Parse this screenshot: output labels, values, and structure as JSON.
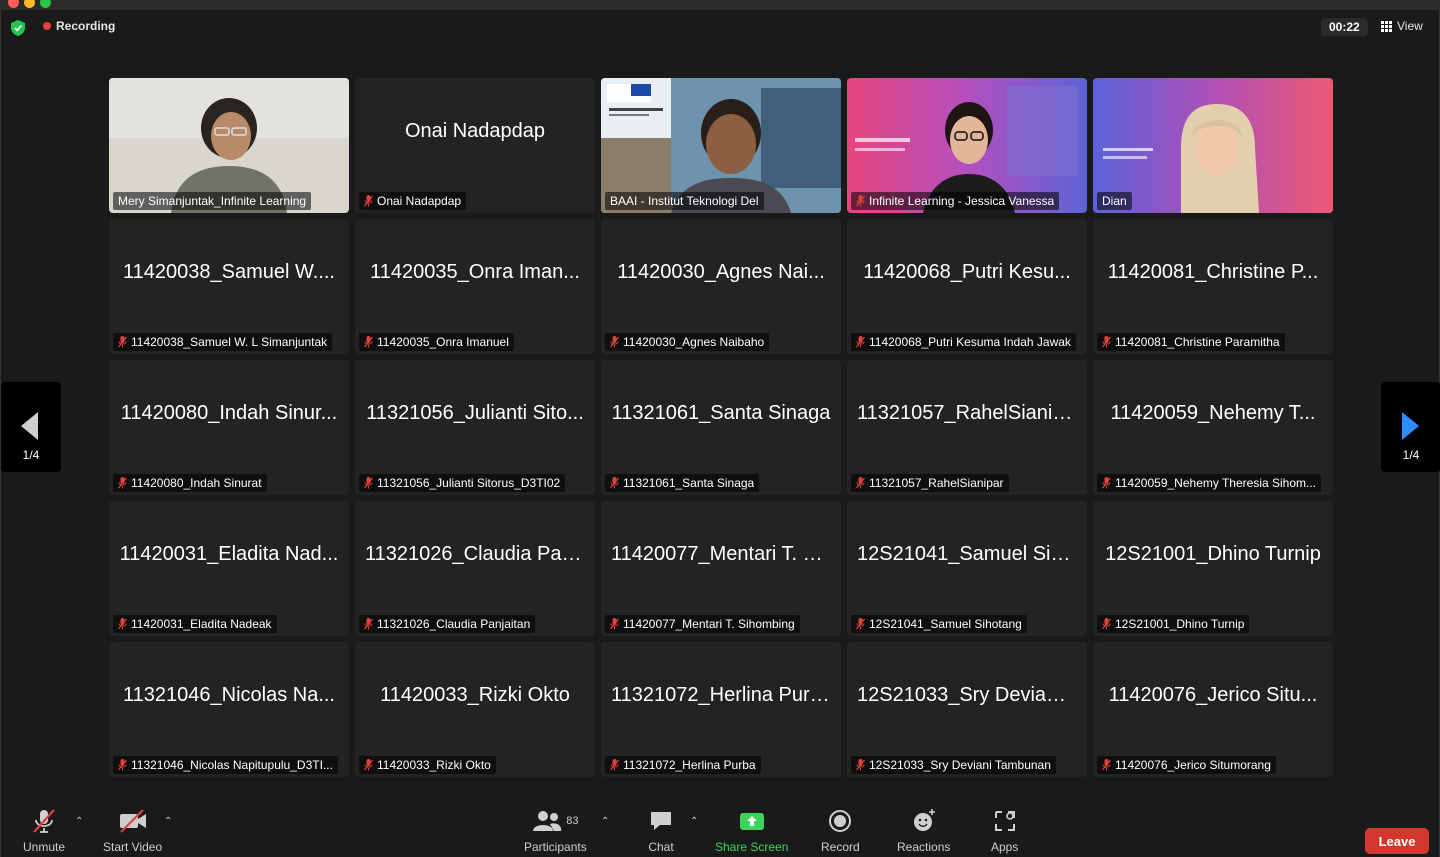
{
  "topbar": {
    "recording_label": "Recording",
    "timer": "00:22",
    "view_label": "View"
  },
  "video_tiles": [
    {
      "label": "Mery Simanjuntak_Infinite Learning",
      "muted": false
    },
    {
      "name": "Onai Nadapdap",
      "label": "Onai Nadapdap",
      "muted": true
    },
    {
      "label": "BAAI - Institut Teknologi Del",
      "muted": false,
      "active": true
    },
    {
      "label": "Infinite Learning - Jessica Vanessa",
      "muted": true
    },
    {
      "label": "Dian",
      "muted": false
    }
  ],
  "participants": [
    {
      "name": "11420038_Samuel W....",
      "label": "11420038_Samuel W. L Simanjuntak"
    },
    {
      "name": "11420035_Onra Iman...",
      "label": "11420035_Onra Imanuel"
    },
    {
      "name": "11420030_Agnes Nai...",
      "label": "11420030_Agnes Naibaho"
    },
    {
      "name": "11420068_Putri Kesu...",
      "label": "11420068_Putri Kesuma Indah Jawak"
    },
    {
      "name": "11420081_Christine P...",
      "label": "11420081_Christine Paramitha"
    },
    {
      "name": "11420080_Indah Sinur...",
      "label": "11420080_Indah Sinurat"
    },
    {
      "name": "11321056_Julianti Sito...",
      "label": "11321056_Julianti Sitorus_D3TI02"
    },
    {
      "name": "11321061_Santa Sinaga",
      "label": "11321061_Santa Sinaga"
    },
    {
      "name": "11321057_RahelSianipar",
      "label": "11321057_RahelSianipar"
    },
    {
      "name": "11420059_Nehemy T...",
      "label": "11420059_Nehemy Theresia Sihom..."
    },
    {
      "name": "11420031_Eladita Nad...",
      "label": "11420031_Eladita Nadeak"
    },
    {
      "name": "11321026_Claudia Pan...",
      "label": "11321026_Claudia Panjaitan"
    },
    {
      "name": "11420077_Mentari T. S...",
      "label": "11420077_Mentari T. Sihombing"
    },
    {
      "name": "12S21041_Samuel Sih...",
      "label": "12S21041_Samuel Sihotang"
    },
    {
      "name": "12S21001_Dhino Turnip",
      "label": "12S21001_Dhino Turnip"
    },
    {
      "name": "11321046_Nicolas Na...",
      "label": "11321046_Nicolas Napitupulu_D3TI..."
    },
    {
      "name": "11420033_Rizki Okto",
      "label": "11420033_Rizki Okto"
    },
    {
      "name": "11321072_Herlina Purba",
      "label": "11321072_Herlina Purba"
    },
    {
      "name": "12S21033_Sry Deviani...",
      "label": "12S21033_Sry Deviani Tambunan"
    },
    {
      "name": "11420076_Jerico Situ...",
      "label": "11420076_Jerico Situmorang"
    }
  ],
  "pagination": {
    "left_page": "1/4",
    "right_page": "1/4"
  },
  "toolbar": {
    "unmute_label": "Unmute",
    "start_video_label": "Start Video",
    "participants_label": "Participants",
    "participants_count": "83",
    "chat_label": "Chat",
    "share_screen_label": "Share Screen",
    "record_label": "Record",
    "reactions_label": "Reactions",
    "apps_label": "Apps",
    "leave_label": "Leave"
  },
  "colors": {
    "active_speaker": "#3fd35a",
    "share_screen": "#3fd35a",
    "leave": "#d3382f",
    "mute_red": "#e0413c",
    "nav_arrow": "#2d8cff"
  }
}
